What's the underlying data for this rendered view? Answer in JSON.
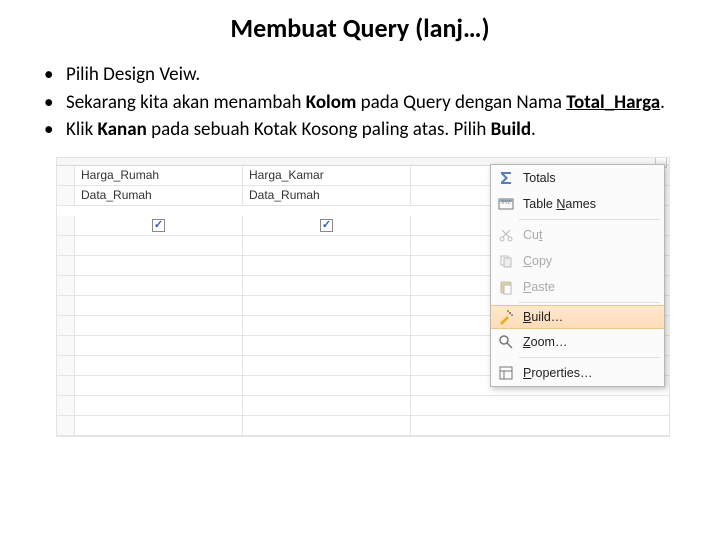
{
  "title": "Membuat  Query (lanj…)",
  "bullets": {
    "b1a": "Pilih Design Veiw.",
    "b2a": "Sekarang kita akan menambah ",
    "b2b": "Kolom",
    "b2c": " pada Query dengan Nama ",
    "b2d": "Total_Harga",
    "b2e": ".",
    "b3a": "Klik ",
    "b3b": "Kanan",
    "b3c": " pada sebuah Kotak Kosong paling atas. Pilih ",
    "b3d": "Build",
    "b3e": "."
  },
  "grid": {
    "r1c1": "Harga_Rumah",
    "r1c2": "Harga_Kamar",
    "r1c3": "",
    "r2c1": "Data_Rumah",
    "r2c2": "Data_Rumah"
  },
  "menu": {
    "totals": "Totals",
    "tablenames_pre": "Table ",
    "tablenames_u": "N",
    "tablenames_post": "ames",
    "cut_pre": "Cu",
    "cut_u": "t",
    "copy_u": "C",
    "copy_post": "opy",
    "paste_u": "P",
    "paste_post": "aste",
    "build_u": "B",
    "build_post": "uild…",
    "zoom_u": "Z",
    "zoom_post": "oom…",
    "props_u": "P",
    "props_post": "roperties…"
  }
}
